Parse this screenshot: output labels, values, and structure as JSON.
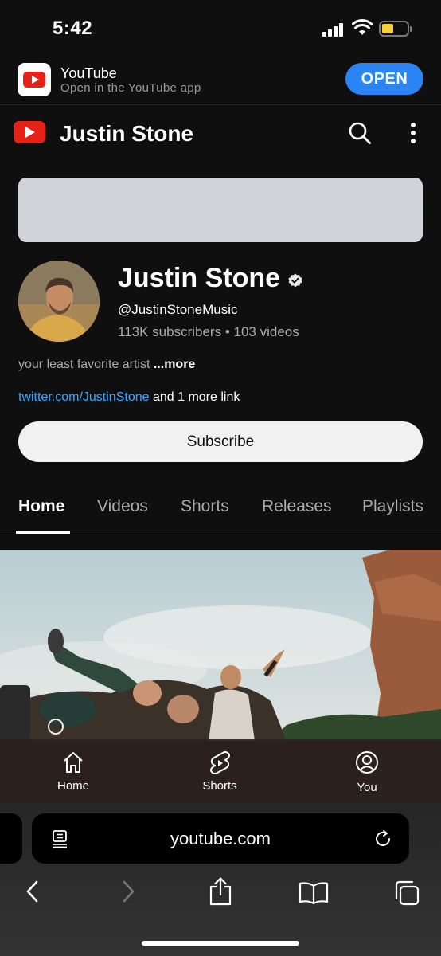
{
  "status_bar": {
    "time": "5:42"
  },
  "app_banner": {
    "name": "YouTube",
    "subtitle": "Open in the YouTube app",
    "open_label": "OPEN"
  },
  "header": {
    "title": "Justin Stone"
  },
  "channel": {
    "name": "Justin Stone",
    "handle": "@JustinStoneMusic",
    "subscribers": "113K subscribers",
    "separator": " • ",
    "video_count": "103 videos",
    "description": "your least favorite artist",
    "more_label": " ...more",
    "link": "twitter.com/JustinStone",
    "extra_links": " and 1 more link",
    "subscribe_label": "Subscribe"
  },
  "tabs": [
    {
      "label": "Home",
      "active": true
    },
    {
      "label": "Videos"
    },
    {
      "label": "Shorts"
    },
    {
      "label": "Releases"
    },
    {
      "label": "Playlists"
    }
  ],
  "bottom_nav": [
    {
      "label": "Home",
      "icon": "home-icon"
    },
    {
      "label": "Shorts",
      "icon": "shorts-icon"
    },
    {
      "label": "You",
      "icon": "account-circle-icon"
    }
  ],
  "browser": {
    "url": "youtube.com",
    "toolbar_icons": [
      "back-icon",
      "forward-icon",
      "share-icon",
      "bookmarks-icon",
      "tabs-icon"
    ]
  },
  "colors": {
    "background": "#0f0f0f",
    "brand_red": "#e62117",
    "open_button": "#2b84f3",
    "link": "#3ea6ff"
  }
}
